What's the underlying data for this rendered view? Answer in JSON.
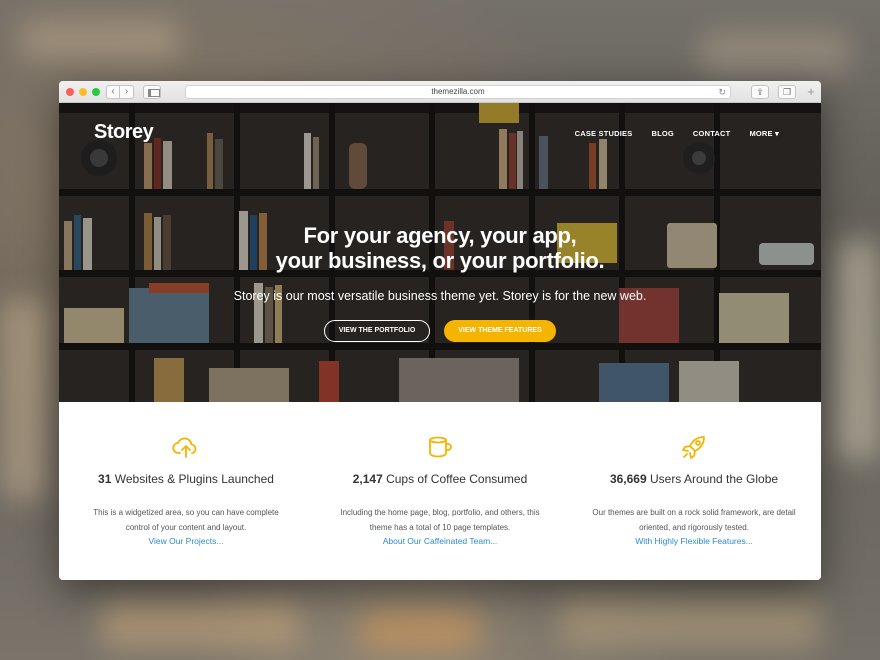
{
  "browser": {
    "url": "themezilla.com"
  },
  "site": {
    "logo": "Storey",
    "nav": [
      {
        "label": "CASE STUDIES"
      },
      {
        "label": "BLOG"
      },
      {
        "label": "CONTACT"
      },
      {
        "label": "MORE ▾"
      }
    ]
  },
  "hero": {
    "title_line1": "For your agency, your app,",
    "title_line2": "your business, or your portfolio.",
    "subtitle": "Storey is our most versatile business theme yet. Storey is for the new web.",
    "btn_portfolio": "VIEW THE PORTFOLIO",
    "btn_features": "VIEW THEME FEATURES"
  },
  "stats": [
    {
      "icon": "cloud-upload-icon",
      "number": "31",
      "label": " Websites & Plugins Launched",
      "body": "This is a widgetized area, so you can have complete control of your content and layout.",
      "link": "View Our Projects..."
    },
    {
      "icon": "coffee-cup-icon",
      "number": "2,147",
      "label": " Cups of Coffee Consumed",
      "body": "Including the home page, blog, portfolio, and others, this theme has a total of 10 page templates.",
      "link": "About Our Caffeinated Team..."
    },
    {
      "icon": "rocket-icon",
      "number": "36,669",
      "label": " Users Around the Globe",
      "body": "Our themes are built on a rock solid framework, are detail oriented, and rigorously tested.",
      "link": "With Highly Flexible Features..."
    }
  ],
  "colors": {
    "accent": "#f5b400",
    "link": "#2a8bd1"
  }
}
